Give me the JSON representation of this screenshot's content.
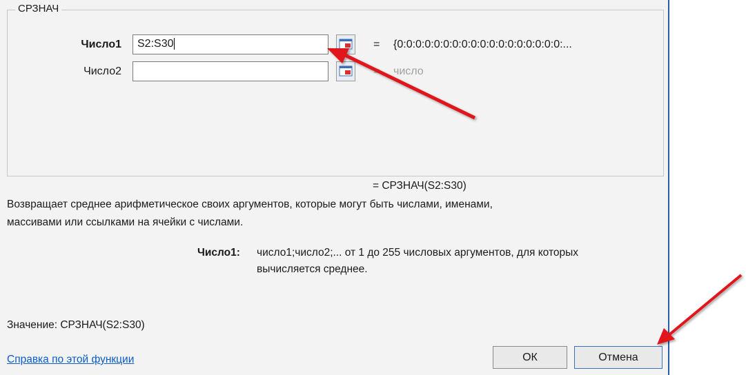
{
  "dialog": {
    "group_title": "СРЗНАЧ",
    "args": [
      {
        "label": "Число1",
        "value": "S2:S30",
        "result": "{0:0:0:0:0:0:0:0:0:0:0:0:0:0:0:0:0:0:...",
        "eq": "="
      },
      {
        "label": "Число2",
        "value": "",
        "result": "число",
        "eq": "="
      }
    ],
    "formula_result": "=  СРЗНАЧ(S2:S30)",
    "description_line1": "Возвращает среднее арифметическое своих аргументов, которые могут быть числами, именами,",
    "description_line2": "массивами или ссылками на ячейки с числами.",
    "arg_help_label": "Число1:",
    "arg_help_line1": "число1;число2;... от 1 до 255 числовых аргументов, для которых",
    "arg_help_line2": "вычисляется среднее.",
    "value_text": "Значение:  СРЗНАЧ(S2:S30)",
    "help_link": "Справка по этой функции",
    "ok_label": "ОК",
    "cancel_label": "Отмена"
  },
  "colors": {
    "arrow": "#e0141b",
    "link": "#0b5cc7",
    "frame": "#2b5aa8"
  },
  "icons": [
    "collapse-dialog-icon",
    "annotation-arrow"
  ]
}
